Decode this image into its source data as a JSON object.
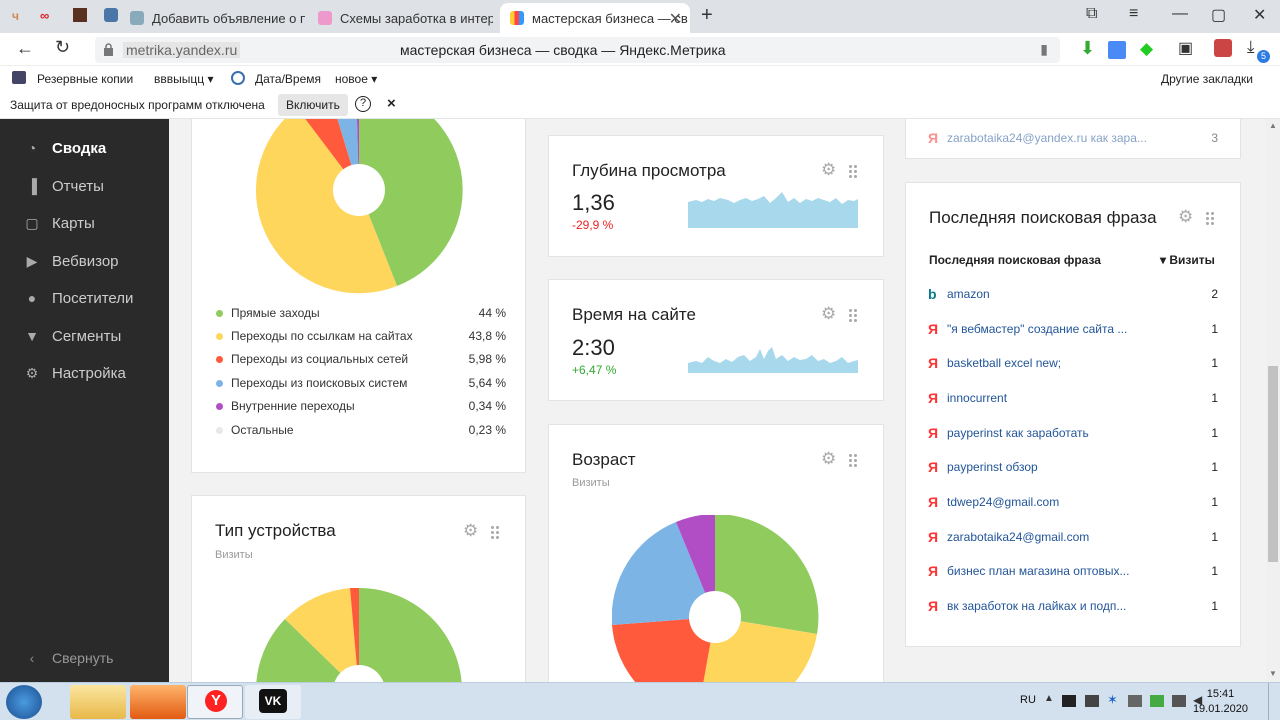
{
  "browser": {
    "tabs": [
      {
        "label": "Добавить объявление о пр",
        "favicon": "vk-icon"
      },
      {
        "label": "Схемы заработка в интерн",
        "favicon": "page-icon"
      },
      {
        "label": "мастерская бизнеса — св",
        "favicon": "metrika-icon",
        "active": true
      }
    ],
    "url_domain": "metrika.yandex.ru",
    "page_title": "мастерская бизнеса — сводка — Яндекс.Метрика",
    "bookmarks": [
      {
        "label": "Резервные копии"
      },
      {
        "label": "вввыыцц ▾"
      },
      {
        "label": "Дата/Время"
      },
      {
        "label": "новое ▾"
      }
    ],
    "other_bookmarks": "Другие закладки",
    "download_badge": "5",
    "warning": {
      "text": "Защита от вредоносных программ отключена",
      "button": "Включить",
      "help": "?",
      "close": "×"
    }
  },
  "sidebar": {
    "items": [
      {
        "label": "Сводка",
        "icon": "gauge-icon",
        "active": true
      },
      {
        "label": "Отчеты",
        "icon": "bar-chart-icon"
      },
      {
        "label": "Карты",
        "icon": "map-icon"
      },
      {
        "label": "Вебвизор",
        "icon": "play-icon"
      },
      {
        "label": "Посетители",
        "icon": "user-icon"
      },
      {
        "label": "Сегменты",
        "icon": "filter-icon"
      },
      {
        "label": "Настройка",
        "icon": "gear-icon"
      }
    ],
    "collapse": "Свернуть"
  },
  "sources_widget": {
    "legend": [
      {
        "label": "Прямые заходы",
        "pct": "44 %",
        "color": "#8fcb5d"
      },
      {
        "label": "Переходы по ссылкам на сайтах",
        "pct": "43,8 %",
        "color": "#ffd65c"
      },
      {
        "label": "Переходы из социальных сетей",
        "pct": "5,98 %",
        "color": "#ff5a3c"
      },
      {
        "label": "Переходы из поисковых систем",
        "pct": "5,64 %",
        "color": "#7cb4e6"
      },
      {
        "label": "Внутренние переходы",
        "pct": "0,34 %",
        "color": "#b14ec6"
      },
      {
        "label": "Остальные",
        "pct": "0,23 %",
        "color": "#e8e8e8"
      }
    ]
  },
  "depth_widget": {
    "title": "Глубина просмотра",
    "value": "1,36",
    "delta": "-29,9 %",
    "delta_color": "#e22"
  },
  "time_widget": {
    "title": "Время на сайте",
    "value": "2:30",
    "delta": "+6,47 %",
    "delta_color": "#3a3"
  },
  "age_widget": {
    "title": "Возраст",
    "subtitle": "Визиты"
  },
  "device_widget": {
    "title": "Тип устройства",
    "subtitle": "Визиты"
  },
  "search_widget": {
    "top_row_text": "zarabotaika24@yandex.ru как зара...",
    "top_row_count": "3",
    "title": "Последняя поисковая фраза",
    "col_phrase": "Последняя поисковая фраза",
    "col_visits": "▾ Визиты",
    "rows": [
      {
        "engine": "bing",
        "phrase": "amazon",
        "count": "2"
      },
      {
        "engine": "yandex",
        "phrase": "\"я вебмастер\" создание сайта ...",
        "count": "1"
      },
      {
        "engine": "yandex",
        "phrase": "basketball excel new;",
        "count": "1"
      },
      {
        "engine": "yandex",
        "phrase": "innocurrent",
        "count": "1"
      },
      {
        "engine": "yandex",
        "phrase": "payperinst как заработать",
        "count": "1"
      },
      {
        "engine": "yandex",
        "phrase": "payperinst обзор",
        "count": "1"
      },
      {
        "engine": "yandex",
        "phrase": "tdwep24@gmail.com",
        "count": "1"
      },
      {
        "engine": "yandex",
        "phrase": "zarabotaika24@gmail.com",
        "count": "1"
      },
      {
        "engine": "yandex",
        "phrase": "бизнес план магазина оптовых...",
        "count": "1"
      },
      {
        "engine": "yandex",
        "phrase": "вк заработок на лайках и подп...",
        "count": "1"
      }
    ]
  },
  "taskbar": {
    "lang": "RU",
    "time": "15:41",
    "date": "19.01.2020"
  }
}
